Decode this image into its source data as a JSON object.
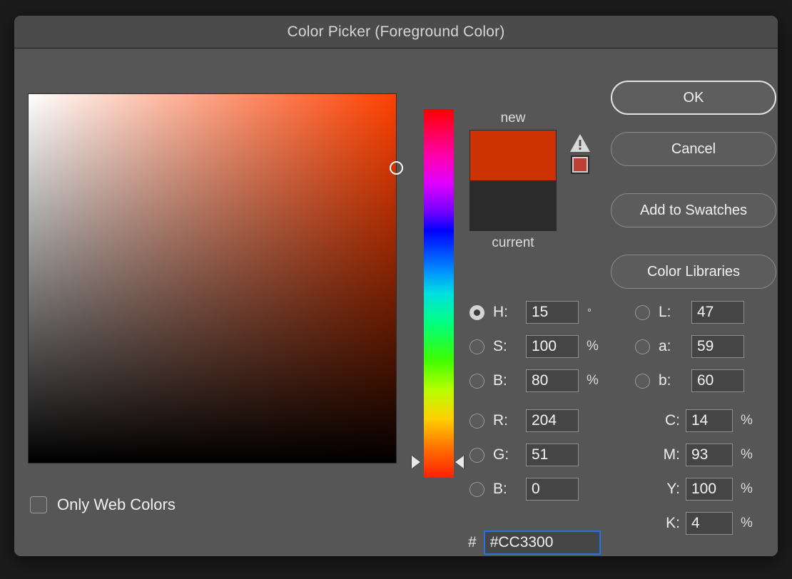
{
  "dialog": {
    "title": "Color Picker (Foreground Color)"
  },
  "preview": {
    "new_label": "new",
    "current_label": "current",
    "new_color": "#CC3300",
    "current_color": "#2B2B2B",
    "gamut_warning_icon": "warning-triangle-icon",
    "gamut_substitute_color": "#BC4033"
  },
  "picker": {
    "hue_color": "#FF4000",
    "cursor_x_pct": 100,
    "cursor_y_pct": 20,
    "hue_marker_pct": 95.8
  },
  "buttons": {
    "ok": "OK",
    "cancel": "Cancel",
    "add_to_swatches": "Add to Swatches",
    "color_libraries": "Color Libraries"
  },
  "hsb": [
    {
      "name": "hue",
      "label": "H:",
      "value": "15",
      "unit": "°",
      "selected": true
    },
    {
      "name": "saturation",
      "label": "S:",
      "value": "100",
      "unit": "%",
      "selected": false
    },
    {
      "name": "brightness",
      "label": "B:",
      "value": "80",
      "unit": "%",
      "selected": false
    }
  ],
  "lab": [
    {
      "name": "lightness",
      "label": "L:",
      "value": "47",
      "unit": "",
      "selected": false
    },
    {
      "name": "a",
      "label": "a:",
      "value": "59",
      "unit": "",
      "selected": false
    },
    {
      "name": "b",
      "label": "b:",
      "value": "60",
      "unit": "",
      "selected": false
    }
  ],
  "rgb": [
    {
      "name": "red",
      "label": "R:",
      "value": "204",
      "unit": "",
      "selected": false
    },
    {
      "name": "green",
      "label": "G:",
      "value": "51",
      "unit": "",
      "selected": false
    },
    {
      "name": "blue",
      "label": "B:",
      "value": "0",
      "unit": "",
      "selected": false
    }
  ],
  "cmyk": [
    {
      "name": "cyan",
      "label": "C:",
      "value": "14",
      "unit": "%"
    },
    {
      "name": "magenta",
      "label": "M:",
      "value": "93",
      "unit": "%"
    },
    {
      "name": "yellow",
      "label": "Y:",
      "value": "100",
      "unit": "%"
    },
    {
      "name": "black",
      "label": "K:",
      "value": "4",
      "unit": "%"
    }
  ],
  "hex": {
    "hash_label": "#",
    "value": "#CC3300"
  },
  "web_colors": {
    "label": "Only Web Colors",
    "checked": false
  },
  "colors": {
    "dialog_bg": "#565656",
    "titlebar_bg": "#4B4B4B",
    "field_bg": "#454545",
    "focus_ring": "#2A6FE0",
    "desktop_bg": "#1B1B1B"
  }
}
